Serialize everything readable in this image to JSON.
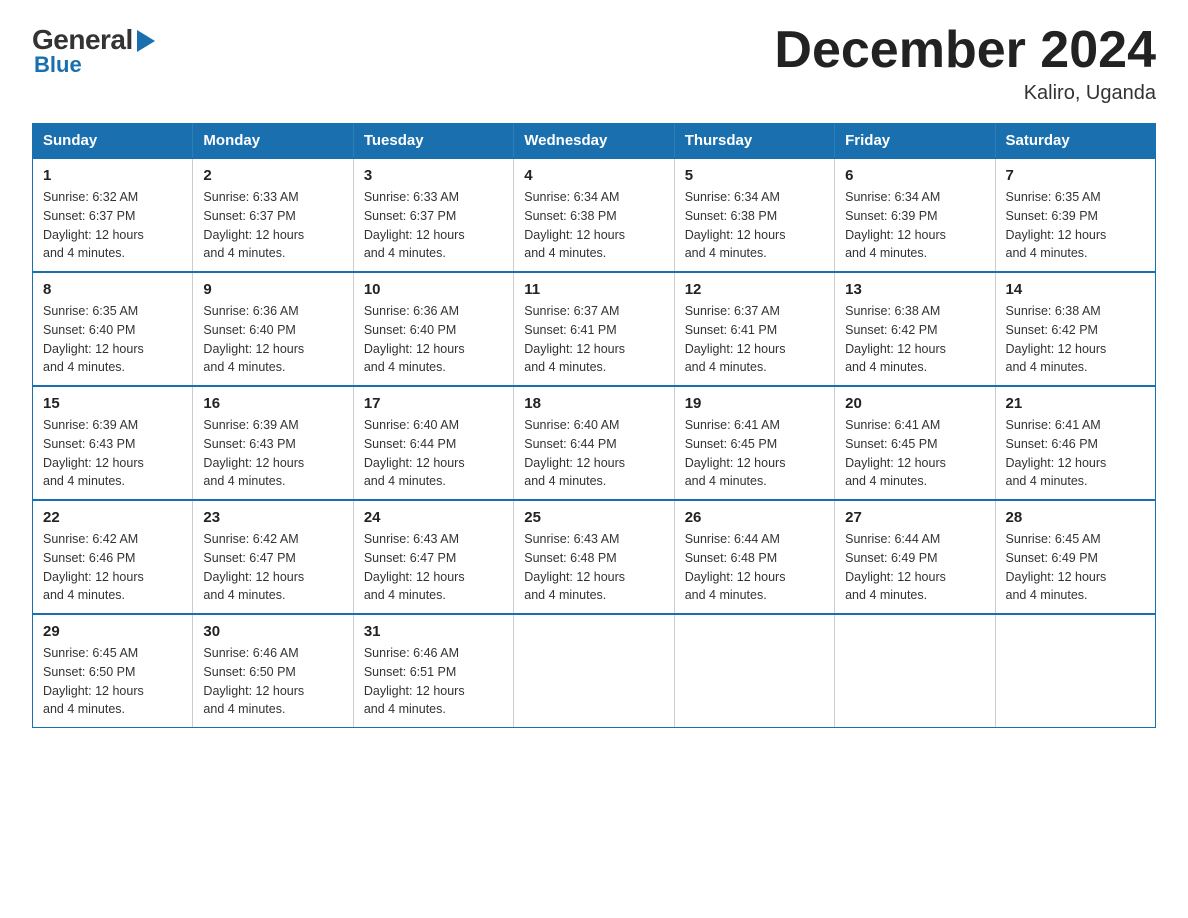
{
  "logo": {
    "general": "General",
    "blue": "Blue"
  },
  "title": "December 2024",
  "location": "Kaliro, Uganda",
  "days_header": [
    "Sunday",
    "Monday",
    "Tuesday",
    "Wednesday",
    "Thursday",
    "Friday",
    "Saturday"
  ],
  "weeks": [
    [
      {
        "num": "1",
        "sunrise": "6:32 AM",
        "sunset": "6:37 PM",
        "daylight": "12 hours and 4 minutes."
      },
      {
        "num": "2",
        "sunrise": "6:33 AM",
        "sunset": "6:37 PM",
        "daylight": "12 hours and 4 minutes."
      },
      {
        "num": "3",
        "sunrise": "6:33 AM",
        "sunset": "6:37 PM",
        "daylight": "12 hours and 4 minutes."
      },
      {
        "num": "4",
        "sunrise": "6:34 AM",
        "sunset": "6:38 PM",
        "daylight": "12 hours and 4 minutes."
      },
      {
        "num": "5",
        "sunrise": "6:34 AM",
        "sunset": "6:38 PM",
        "daylight": "12 hours and 4 minutes."
      },
      {
        "num": "6",
        "sunrise": "6:34 AM",
        "sunset": "6:39 PM",
        "daylight": "12 hours and 4 minutes."
      },
      {
        "num": "7",
        "sunrise": "6:35 AM",
        "sunset": "6:39 PM",
        "daylight": "12 hours and 4 minutes."
      }
    ],
    [
      {
        "num": "8",
        "sunrise": "6:35 AM",
        "sunset": "6:40 PM",
        "daylight": "12 hours and 4 minutes."
      },
      {
        "num": "9",
        "sunrise": "6:36 AM",
        "sunset": "6:40 PM",
        "daylight": "12 hours and 4 minutes."
      },
      {
        "num": "10",
        "sunrise": "6:36 AM",
        "sunset": "6:40 PM",
        "daylight": "12 hours and 4 minutes."
      },
      {
        "num": "11",
        "sunrise": "6:37 AM",
        "sunset": "6:41 PM",
        "daylight": "12 hours and 4 minutes."
      },
      {
        "num": "12",
        "sunrise": "6:37 AM",
        "sunset": "6:41 PM",
        "daylight": "12 hours and 4 minutes."
      },
      {
        "num": "13",
        "sunrise": "6:38 AM",
        "sunset": "6:42 PM",
        "daylight": "12 hours and 4 minutes."
      },
      {
        "num": "14",
        "sunrise": "6:38 AM",
        "sunset": "6:42 PM",
        "daylight": "12 hours and 4 minutes."
      }
    ],
    [
      {
        "num": "15",
        "sunrise": "6:39 AM",
        "sunset": "6:43 PM",
        "daylight": "12 hours and 4 minutes."
      },
      {
        "num": "16",
        "sunrise": "6:39 AM",
        "sunset": "6:43 PM",
        "daylight": "12 hours and 4 minutes."
      },
      {
        "num": "17",
        "sunrise": "6:40 AM",
        "sunset": "6:44 PM",
        "daylight": "12 hours and 4 minutes."
      },
      {
        "num": "18",
        "sunrise": "6:40 AM",
        "sunset": "6:44 PM",
        "daylight": "12 hours and 4 minutes."
      },
      {
        "num": "19",
        "sunrise": "6:41 AM",
        "sunset": "6:45 PM",
        "daylight": "12 hours and 4 minutes."
      },
      {
        "num": "20",
        "sunrise": "6:41 AM",
        "sunset": "6:45 PM",
        "daylight": "12 hours and 4 minutes."
      },
      {
        "num": "21",
        "sunrise": "6:41 AM",
        "sunset": "6:46 PM",
        "daylight": "12 hours and 4 minutes."
      }
    ],
    [
      {
        "num": "22",
        "sunrise": "6:42 AM",
        "sunset": "6:46 PM",
        "daylight": "12 hours and 4 minutes."
      },
      {
        "num": "23",
        "sunrise": "6:42 AM",
        "sunset": "6:47 PM",
        "daylight": "12 hours and 4 minutes."
      },
      {
        "num": "24",
        "sunrise": "6:43 AM",
        "sunset": "6:47 PM",
        "daylight": "12 hours and 4 minutes."
      },
      {
        "num": "25",
        "sunrise": "6:43 AM",
        "sunset": "6:48 PM",
        "daylight": "12 hours and 4 minutes."
      },
      {
        "num": "26",
        "sunrise": "6:44 AM",
        "sunset": "6:48 PM",
        "daylight": "12 hours and 4 minutes."
      },
      {
        "num": "27",
        "sunrise": "6:44 AM",
        "sunset": "6:49 PM",
        "daylight": "12 hours and 4 minutes."
      },
      {
        "num": "28",
        "sunrise": "6:45 AM",
        "sunset": "6:49 PM",
        "daylight": "12 hours and 4 minutes."
      }
    ],
    [
      {
        "num": "29",
        "sunrise": "6:45 AM",
        "sunset": "6:50 PM",
        "daylight": "12 hours and 4 minutes."
      },
      {
        "num": "30",
        "sunrise": "6:46 AM",
        "sunset": "6:50 PM",
        "daylight": "12 hours and 4 minutes."
      },
      {
        "num": "31",
        "sunrise": "6:46 AM",
        "sunset": "6:51 PM",
        "daylight": "12 hours and 4 minutes."
      },
      null,
      null,
      null,
      null
    ]
  ],
  "labels": {
    "sunrise": "Sunrise:",
    "sunset": "Sunset:",
    "daylight": "Daylight:"
  }
}
